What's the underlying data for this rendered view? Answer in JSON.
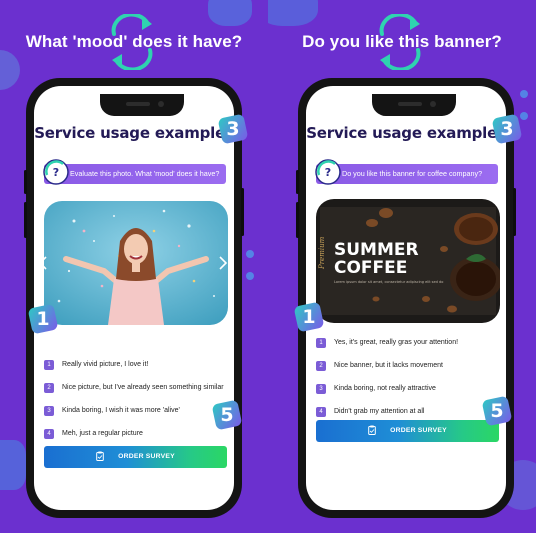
{
  "panels": [
    {
      "headline": "What 'mood' does it have?",
      "title": "Service usage examples",
      "question": "Evaluate this photo. What 'mood' does it have?",
      "answers": [
        {
          "num": "1",
          "text": "Really vivid picture, I love it!"
        },
        {
          "num": "2",
          "text": "Nice picture, but I've already seen something similar"
        },
        {
          "num": "3",
          "text": "Kinda boring, I wish it was more 'alive'"
        },
        {
          "num": "4",
          "text": "Meh, just a regular picture"
        }
      ],
      "order_label": "ORDER SURVEY",
      "badges": [
        "3",
        "1",
        "5"
      ]
    },
    {
      "headline": "Do you like this banner?",
      "title": "Service usage examples",
      "question": "Do you like this banner for coffee company?",
      "banner": {
        "line1": "SUMMER",
        "line2": "COFFEE",
        "tag": "Premium",
        "fine_print": "Lorem ipsum dolor sit amet, consectetur adipiscing elit sed do"
      },
      "answers": [
        {
          "num": "1",
          "text": "Yes, it's great, really gras your attention!"
        },
        {
          "num": "2",
          "text": "Nice banner, but it lacks movement"
        },
        {
          "num": "3",
          "text": "Kinda boring, not really attractive"
        },
        {
          "num": "4",
          "text": "Didn't grab my attention at all"
        }
      ],
      "order_label": "ORDER SURVEY",
      "badges": [
        "3",
        "1",
        "5"
      ]
    }
  ],
  "colors": {
    "background": "#6b30cf",
    "title": "#231a56",
    "question_bar": "#8a5ae6",
    "answer_number": "#7b5cd6",
    "order_start": "#1a6fd1",
    "order_end": "#2bd764",
    "badge_start": "#2ec9c4",
    "badge_end": "#7a5ae8",
    "arrow": "#2fd3b0"
  }
}
